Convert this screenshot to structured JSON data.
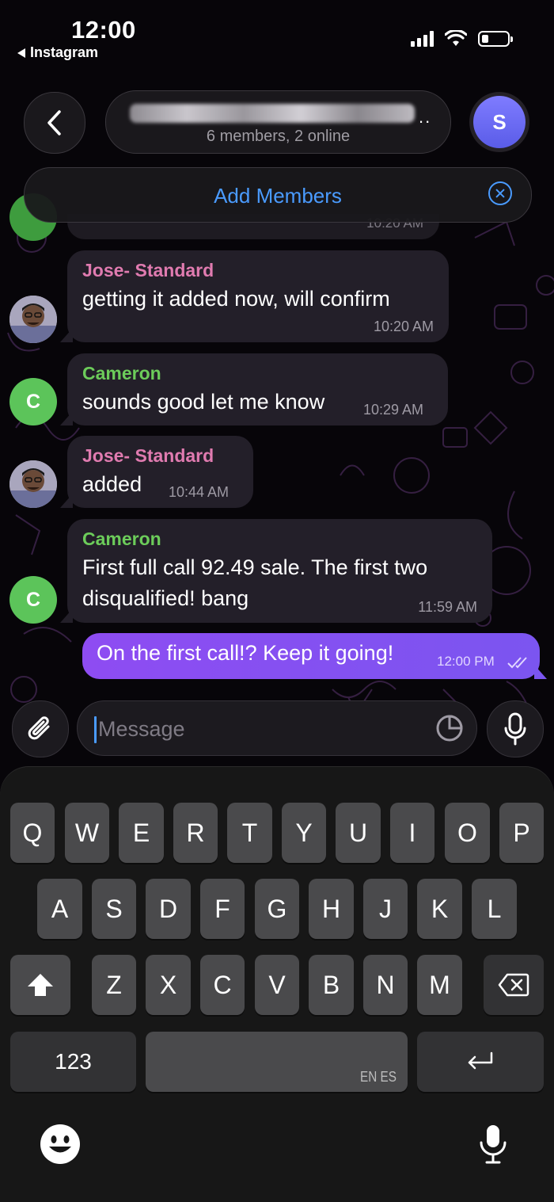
{
  "status_bar": {
    "time": "12:00",
    "back_app": "Instagram"
  },
  "header": {
    "subtitle": "6 members, 2 online",
    "avatar_initial": "S"
  },
  "add_members": {
    "label": "Add Members"
  },
  "previous_message": {
    "time": "10:20 AM"
  },
  "messages": [
    {
      "sender": "Jose- Standard",
      "text": "getting it added now, will confirm",
      "time": "10:20 AM"
    },
    {
      "sender": "Cameron",
      "text": "sounds good let me know",
      "time": "10:29 AM",
      "avatar_initial": "C"
    },
    {
      "sender": "Jose- Standard",
      "text": "added",
      "time": "10:44 AM"
    },
    {
      "sender": "Cameron",
      "text_line1": "First full call 92.49 sale. The first two",
      "text_line2": "disqualified! bang",
      "time": "11:59 AM",
      "avatar_initial": "C"
    }
  ],
  "outgoing": {
    "text": "On the first call!? Keep it going!",
    "time": "12:00 PM"
  },
  "composer": {
    "placeholder": "Message"
  },
  "keyboard": {
    "row1": [
      "Q",
      "W",
      "E",
      "R",
      "T",
      "Y",
      "U",
      "I",
      "O",
      "P"
    ],
    "row2": [
      "A",
      "S",
      "D",
      "F",
      "G",
      "H",
      "J",
      "K",
      "L"
    ],
    "row3": [
      "Z",
      "X",
      "C",
      "V",
      "B",
      "N",
      "M"
    ],
    "numbers_label": "123",
    "space_label": "EN ES"
  },
  "colors": {
    "accent_blue": "#4a9bff",
    "jose_name": "#e07bb0",
    "cameron_name": "#6ccc5a",
    "outgoing_bubble": "#8e4cf2"
  },
  "icons": {
    "back": "chevron-left-icon",
    "attach": "paperclip-icon",
    "sticker": "sticker-icon",
    "mic": "microphone-icon",
    "shift": "shift-icon",
    "delete": "backspace-icon",
    "return": "return-icon",
    "emoji": "emoji-icon",
    "dictation": "microphone-icon"
  }
}
